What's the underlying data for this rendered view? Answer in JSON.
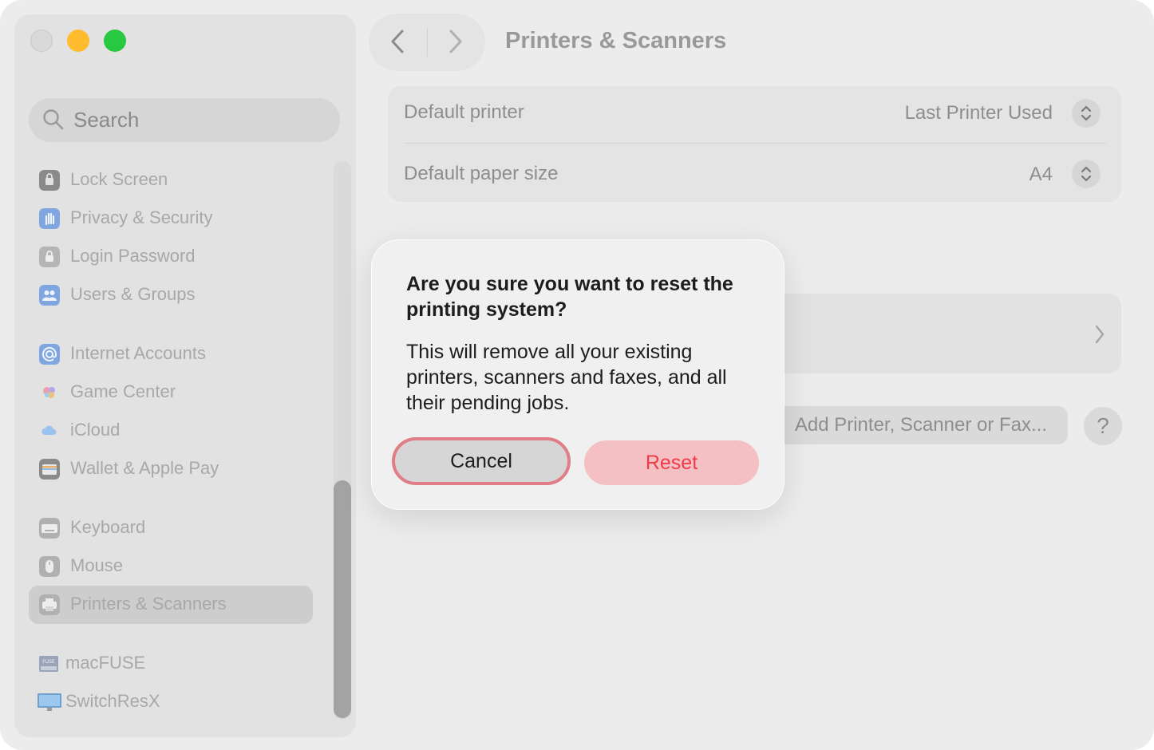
{
  "sidebar": {
    "search_placeholder": "Search",
    "items": [
      {
        "label": "Lock Screen",
        "icon": "lock-icon",
        "color": "#8a8a8a"
      },
      {
        "label": "Privacy & Security",
        "icon": "hand-icon",
        "color": "#7fa6e0"
      },
      {
        "label": "Login Password",
        "icon": "padlock-icon",
        "color": "#b5b5b5"
      },
      {
        "label": "Users & Groups",
        "icon": "users-icon",
        "color": "#7fa6e0"
      },
      {
        "label": "Internet Accounts",
        "icon": "at-icon",
        "color": "#7fa6e0"
      },
      {
        "label": "Game Center",
        "icon": "game-center-icon",
        "color": "#e090a0"
      },
      {
        "label": "iCloud",
        "icon": "cloud-icon",
        "color": "#9cc2ee"
      },
      {
        "label": "Wallet & Apple Pay",
        "icon": "wallet-icon",
        "color": "#8a8a8a"
      },
      {
        "label": "Keyboard",
        "icon": "keyboard-icon",
        "color": "#b0b0b0"
      },
      {
        "label": "Mouse",
        "icon": "mouse-icon",
        "color": "#b0b0b0"
      },
      {
        "label": "Printers & Scanners",
        "icon": "printer-icon",
        "color": "#b0b0b0"
      },
      {
        "label": "macFUSE",
        "icon": "macfuse-icon",
        "color": "#9aa4b8"
      },
      {
        "label": "SwitchResX",
        "icon": "monitor-icon",
        "color": "#6fa0d0"
      }
    ]
  },
  "header": {
    "title": "Printers & Scanners"
  },
  "settings": {
    "default_printer_label": "Default printer",
    "default_printer_value": "Last Printer Used",
    "paper_size_label": "Default paper size",
    "paper_size_value": "A4"
  },
  "actions": {
    "add_label": "Add Printer, Scanner or Fax...",
    "help_label": "?"
  },
  "dialog": {
    "title": "Are you sure you want to reset the printing system?",
    "message": "This will remove all your existing printers, scanners and faxes, and all their pending jobs.",
    "cancel_label": "Cancel",
    "reset_label": "Reset"
  }
}
